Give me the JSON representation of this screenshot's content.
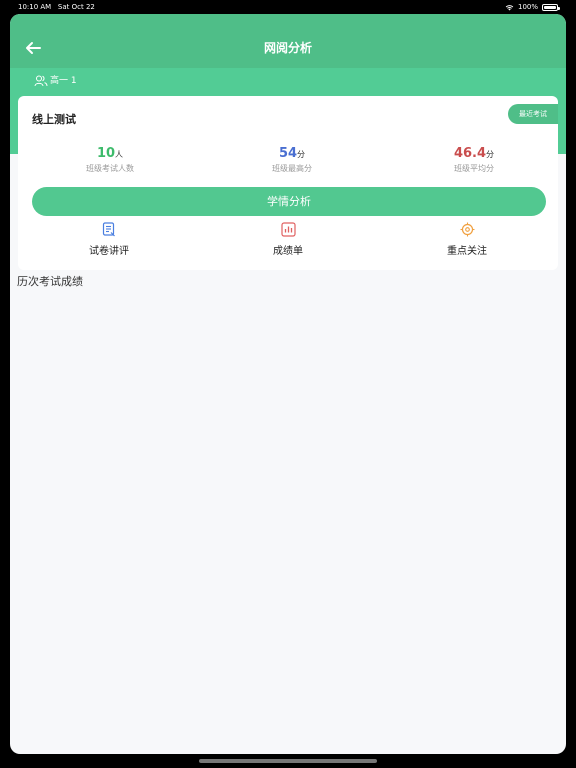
{
  "status_bar": {
    "time": "10:10 AM",
    "date": "Sat Oct 22",
    "battery": "100%"
  },
  "header": {
    "title": "网阅分析"
  },
  "class_selector": {
    "label": "高一 1"
  },
  "exam_card": {
    "title": "线上测试",
    "recent_exam_label": "最近考试",
    "stats": [
      {
        "value": "10",
        "unit": "人",
        "label": "班级考试人数",
        "color": "#3dbb6b"
      },
      {
        "value": "54",
        "unit": "分",
        "label": "班级最高分",
        "color": "#4a6fd1"
      },
      {
        "value": "46.4",
        "unit": "分",
        "label": "班级平均分",
        "color": "#c94d4d"
      }
    ],
    "analysis_button": "学情分析",
    "tools": [
      {
        "label": "试卷讲评",
        "icon": "paper-review-icon",
        "color": "#4a7fe0"
      },
      {
        "label": "成绩单",
        "icon": "report-chart-icon",
        "color": "#e06060"
      },
      {
        "label": "重点关注",
        "icon": "target-icon",
        "color": "#f0a040"
      }
    ]
  },
  "history_section": {
    "title": "历次考试成绩"
  },
  "colors": {
    "primary": "#4fbe88",
    "primary_light": "#52cc95",
    "background": "#f7f8fa"
  }
}
